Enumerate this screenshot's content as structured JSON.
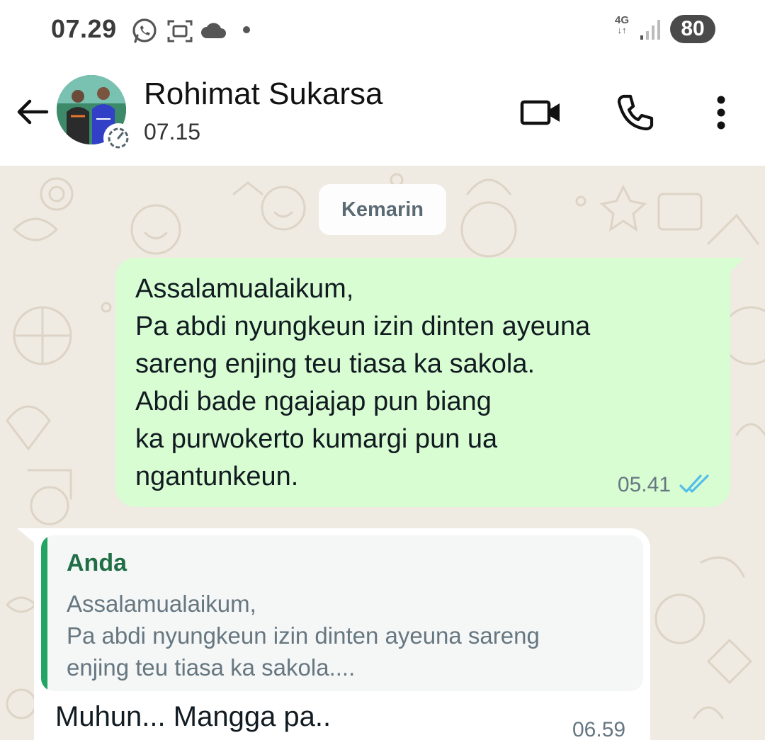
{
  "status_bar": {
    "time": "07.29",
    "network": "4G",
    "battery": "80",
    "icons": [
      "whatsapp-icon",
      "screenshot-icon",
      "cloud-icon",
      "dot-icon",
      "signal-icon"
    ]
  },
  "header": {
    "contact_name": "Rohimat Sukarsa",
    "last_seen": "07.15",
    "icons": [
      "back-arrow-icon",
      "video-call-icon",
      "phone-icon",
      "more-vert-icon"
    ]
  },
  "chat": {
    "date_chip": "Kemarin",
    "messages": [
      {
        "direction": "outgoing",
        "text": "Assalamualaikum,\nPa abdi nyungkeun izin dinten ayeuna\nsareng enjing teu tiasa ka sakola.\nAbdi bade ngajajap pun biang\nka purwokerto kumargi pun ua\nngantunkeun.",
        "time": "05.41",
        "status": "read"
      },
      {
        "direction": "incoming",
        "quote_author": "Anda",
        "quote_text": "Assalamualaikum,\nPa abdi nyungkeun izin dinten ayeuna sareng\nenjing teu tiasa ka sakola....",
        "text": "Muhun... Mangga pa..",
        "time": "06.59"
      }
    ]
  },
  "colors": {
    "outgoing_bubble": "#d9fdd3",
    "chat_background": "#efeae2",
    "read_ticks": "#53bdeb",
    "quote_bar": "#21a464",
    "quote_author": "#1f6e45"
  }
}
